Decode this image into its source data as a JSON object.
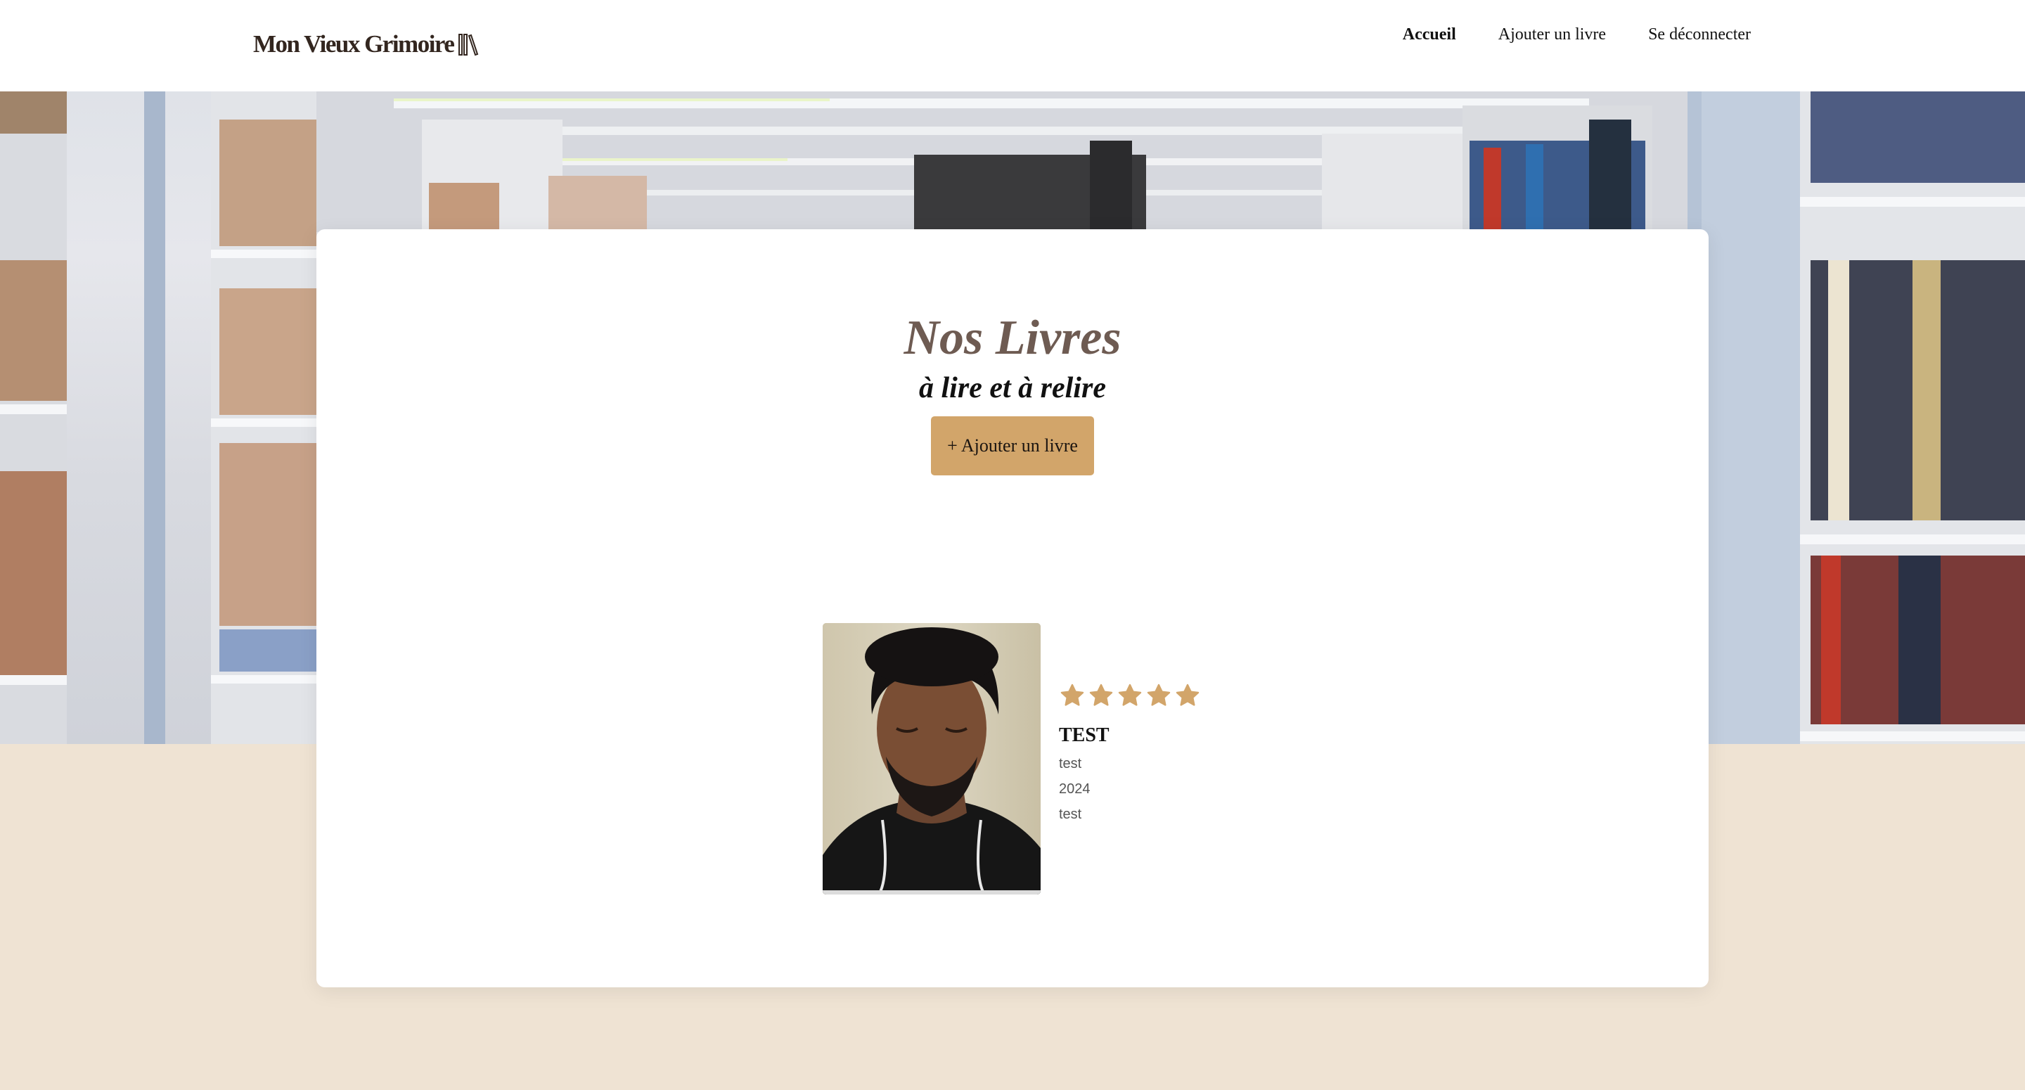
{
  "header": {
    "logo_text": "Mon Vieux Grimoire",
    "nav": [
      {
        "label": "Accueil",
        "active": true
      },
      {
        "label": "Ajouter un livre",
        "active": false
      },
      {
        "label": "Se déconnecter",
        "active": false
      }
    ]
  },
  "main": {
    "title": "Nos Livres",
    "subtitle": "à lire et à relire",
    "add_button_label": "+ Ajouter un livre"
  },
  "books": [
    {
      "rating": 5,
      "rating_max": 5,
      "title": "TEST",
      "author": "test",
      "year": "2024",
      "genre": "test"
    }
  ],
  "colors": {
    "accent": "#d2a56a",
    "page_background": "#efe3d3",
    "title": "#6e5b52",
    "logo": "#33261f"
  },
  "icons": {
    "logo": "books-icon",
    "rating": "star-icon"
  }
}
